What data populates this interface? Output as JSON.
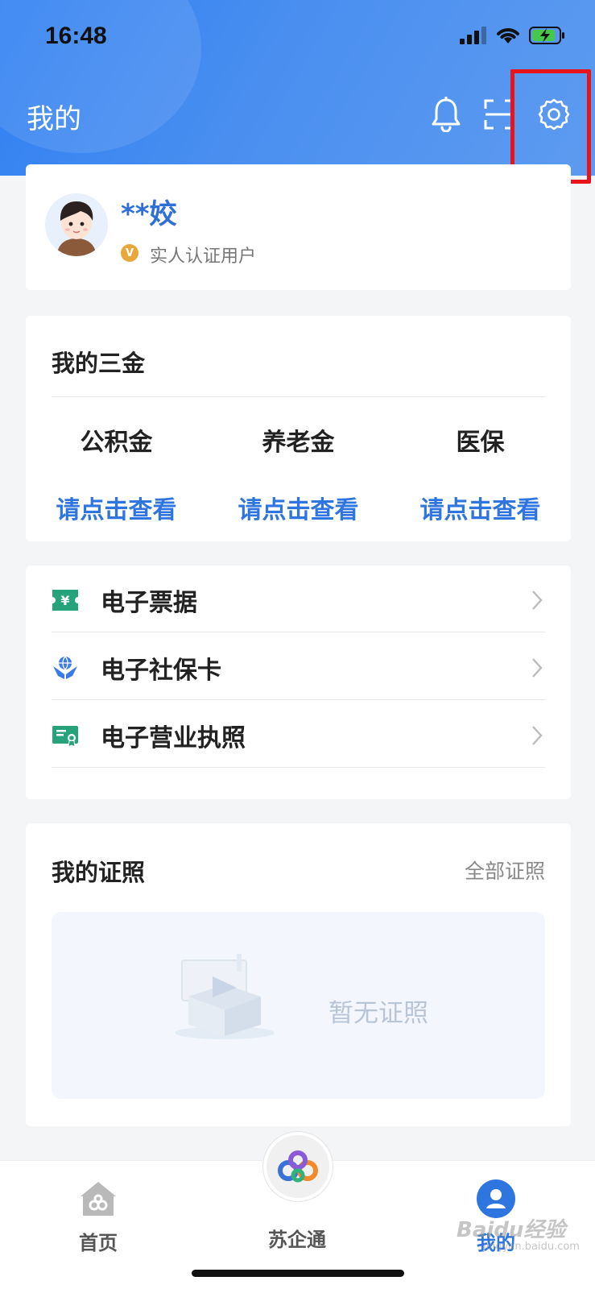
{
  "status_bar": {
    "time": "16:48"
  },
  "header": {
    "title": "我的"
  },
  "profile": {
    "name": "**姣",
    "verify_badge": "V",
    "verify_text": "实人认证用户"
  },
  "funds": {
    "title": "我的三金",
    "items": [
      {
        "name": "公积金",
        "link": "请点击查看"
      },
      {
        "name": "养老金",
        "link": "请点击查看"
      },
      {
        "name": "医保",
        "link": "请点击查看"
      }
    ]
  },
  "services": {
    "items": [
      {
        "label": "电子票据",
        "icon": "receipt-icon"
      },
      {
        "label": "电子社保卡",
        "icon": "social-security-icon"
      },
      {
        "label": "电子营业执照",
        "icon": "business-license-icon"
      }
    ]
  },
  "licenses": {
    "title": "我的证照",
    "all_link": "全部证照",
    "empty_text": "暂无证照"
  },
  "tab_bar": {
    "tabs": [
      {
        "label": "首页",
        "icon": "home-icon"
      },
      {
        "label": "苏企通",
        "icon": "suqitong-logo-icon"
      },
      {
        "label": "我的",
        "icon": "user-icon"
      }
    ]
  },
  "watermark": {
    "brand": "Baidu经验",
    "url": "jingyan.baidu.com"
  },
  "colors": {
    "primary": "#2f75e0",
    "header_gradient_start": "#2f7ff2",
    "highlight": "#e8141b",
    "verify_badge": "#e7a83a"
  }
}
